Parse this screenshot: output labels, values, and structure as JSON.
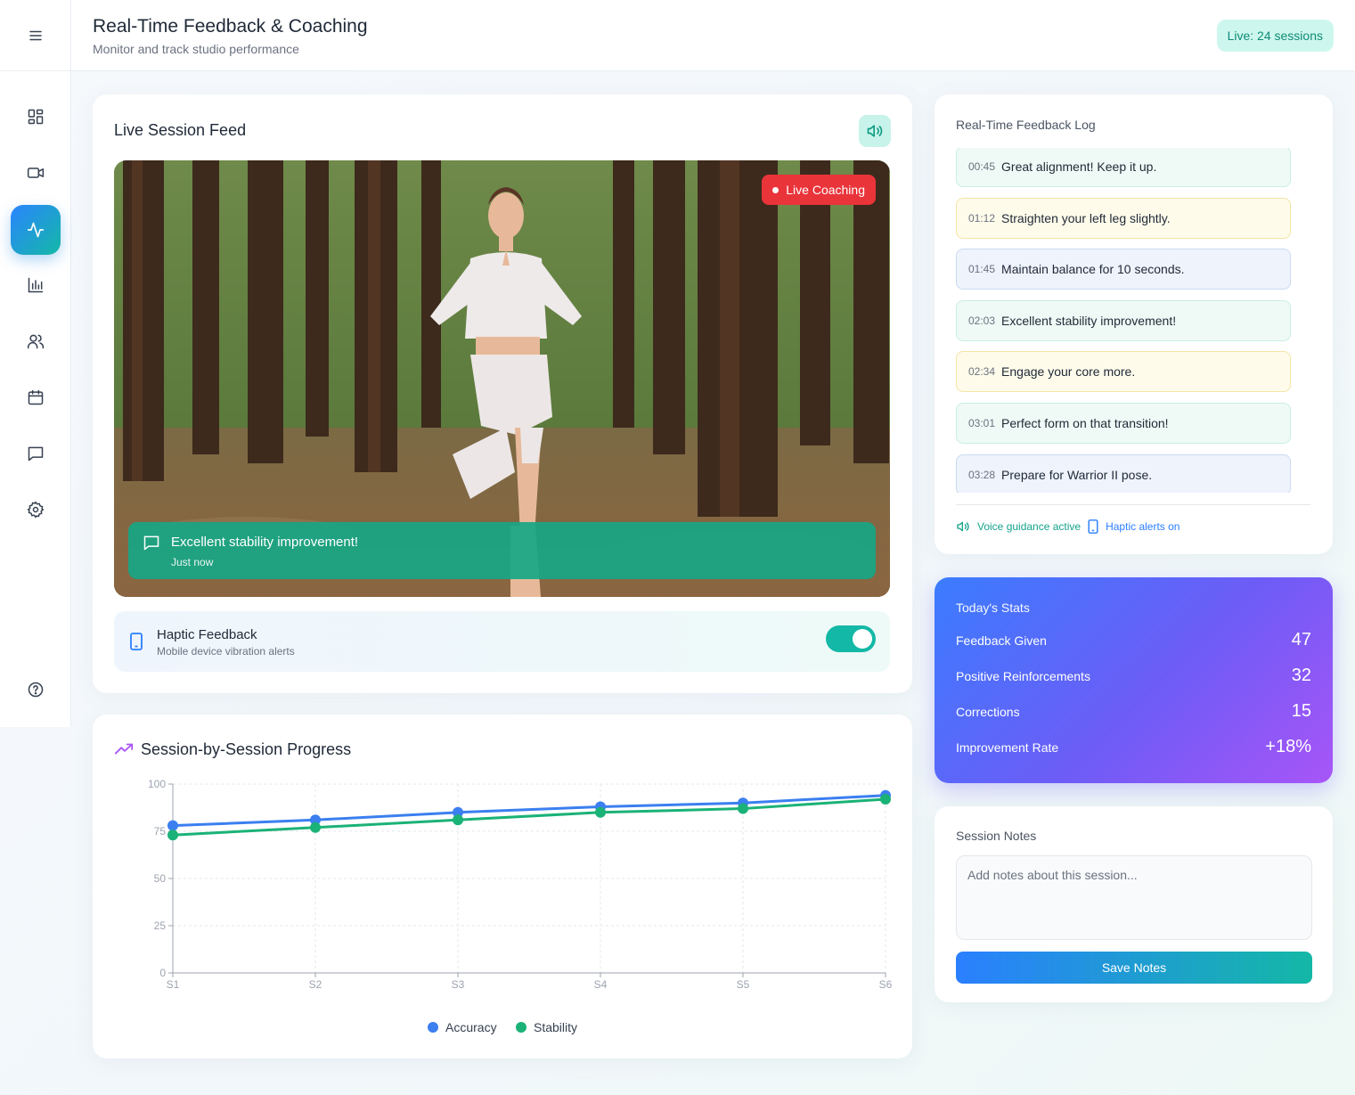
{
  "header": {
    "title": "Real-Time Feedback & Coaching",
    "subtitle": "Monitor and track studio performance",
    "live_badge": "Live: 24 sessions"
  },
  "sidebar": {
    "items": [
      {
        "icon": "grid-icon",
        "active": false
      },
      {
        "icon": "video-icon",
        "active": false
      },
      {
        "icon": "activity-icon",
        "active": true
      },
      {
        "icon": "bar-chart-icon",
        "active": false
      },
      {
        "icon": "users-icon",
        "active": false
      },
      {
        "icon": "calendar-icon",
        "active": false
      },
      {
        "icon": "message-icon",
        "active": false
      },
      {
        "icon": "settings-icon",
        "active": false
      },
      {
        "icon": "help-icon",
        "active": false
      }
    ]
  },
  "feed": {
    "title": "Live Session Feed",
    "live_tag": "Live Coaching",
    "toast_message": "Excellent stability improvement!",
    "toast_time": "Just now",
    "haptic_title": "Haptic Feedback",
    "haptic_subtitle": "Mobile device vibration alerts",
    "haptic_enabled": true
  },
  "progress": {
    "title": "Session-by-Session Progress"
  },
  "chart_data": {
    "type": "line",
    "categories": [
      "S1",
      "S2",
      "S3",
      "S4",
      "S5",
      "S6"
    ],
    "series": [
      {
        "name": "Accuracy",
        "color": "#3b7ff0",
        "values": [
          78,
          81,
          85,
          88,
          90,
          94
        ]
      },
      {
        "name": "Stability",
        "color": "#1bb277",
        "values": [
          73,
          77,
          81,
          85,
          87,
          92
        ]
      }
    ],
    "ylim": [
      0,
      100
    ],
    "yticks": [
      0,
      25,
      50,
      75,
      100
    ],
    "grid": true,
    "legend": "bottom"
  },
  "log": {
    "title": "Real-Time Feedback Log",
    "items": [
      {
        "time": "00:45",
        "text": "Great alignment! Keep it up.",
        "tone": "green"
      },
      {
        "time": "01:12",
        "text": "Straighten your left leg slightly.",
        "tone": "yellow"
      },
      {
        "time": "01:45",
        "text": "Maintain balance for 10 seconds.",
        "tone": "blue"
      },
      {
        "time": "02:03",
        "text": "Excellent stability improvement!",
        "tone": "green"
      },
      {
        "time": "02:34",
        "text": "Engage your core more.",
        "tone": "yellow"
      },
      {
        "time": "03:01",
        "text": "Perfect form on that transition!",
        "tone": "green"
      },
      {
        "time": "03:28",
        "text": "Prepare for Warrior II pose.",
        "tone": "blue"
      }
    ],
    "voice_status": "Voice guidance active",
    "haptic_status": "Haptic alerts on"
  },
  "stats": {
    "title": "Today's Stats",
    "rows": [
      {
        "label": "Feedback Given",
        "value": "47"
      },
      {
        "label": "Positive Reinforcements",
        "value": "32"
      },
      {
        "label": "Corrections",
        "value": "15"
      },
      {
        "label": "Improvement Rate",
        "value": "+18%"
      }
    ]
  },
  "notes": {
    "title": "Session Notes",
    "placeholder": "Add notes about this session...",
    "value": "",
    "save_label": "Save Notes"
  }
}
